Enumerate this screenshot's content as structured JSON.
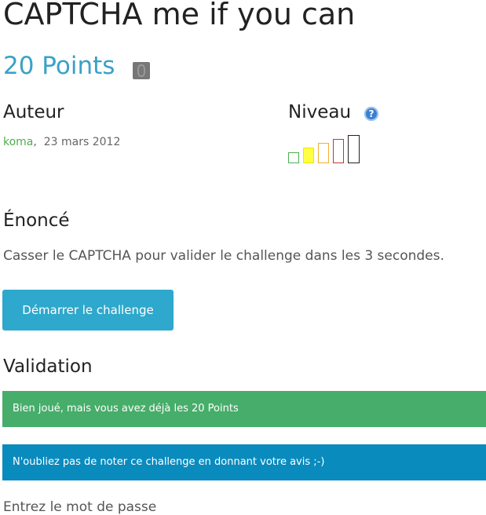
{
  "challenge": {
    "title": "CAPTCHA me if you can",
    "points": "20 Points",
    "medal_icon": "medal-icon"
  },
  "author_section": {
    "heading": "Auteur",
    "author_name": "koma",
    "separator": ",",
    "date": "23 mars 2012"
  },
  "level_section": {
    "heading": "Niveau",
    "help_icon": "question-icon",
    "help_glyph": "?",
    "level_value": 2,
    "level_max": 5,
    "bar_colors": [
      "#4caf50",
      "#f2e600",
      "#f0b030",
      "#c0392b",
      "#222222"
    ],
    "filled_color": "#ffff44"
  },
  "statement": {
    "heading": "Énoncé",
    "text": "Casser le CAPTCHA pour valider le challenge dans les 3 secondes."
  },
  "start_button": {
    "label": "Démarrer le challenge"
  },
  "validation": {
    "heading": "Validation",
    "success_message": "Bien joué, mais vous avez déjà les 20 Points",
    "info_message": "N'oubliez pas de noter ce challenge en donnant votre avis ;-)",
    "next_text": "Entrez le mot de passe"
  },
  "colors": {
    "points": "#3aa1c8",
    "author_link": "#4caf50",
    "button": "#2ea8cc",
    "success": "#47ad6a",
    "info": "#0a8bbe"
  }
}
